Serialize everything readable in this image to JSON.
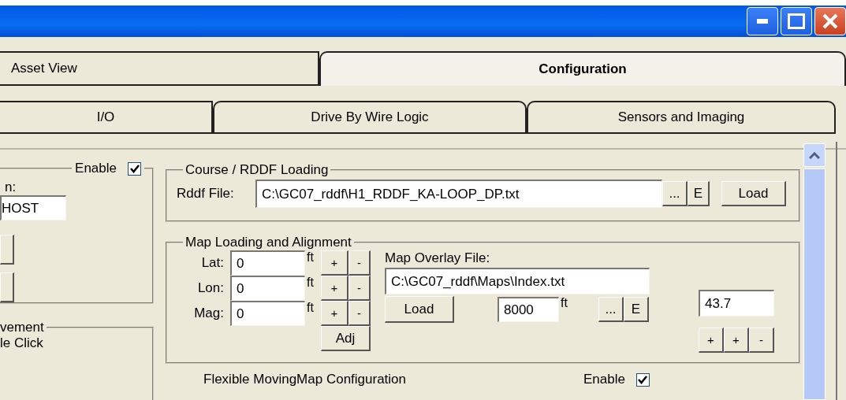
{
  "main_tabs": [
    {
      "label": "Asset View",
      "selected": false
    },
    {
      "label": "Configuration",
      "selected": true
    }
  ],
  "sub_tabs": [
    {
      "label": "I/O",
      "selected": false
    },
    {
      "label": "Drive By Wire Logic",
      "selected": false
    },
    {
      "label": "Sensors and Imaging",
      "selected": false
    }
  ],
  "left_panel": {
    "enable_label": "Enable",
    "enable_checked": true,
    "field_label": "n:",
    "field_value": "HOST",
    "group_title": "vement",
    "option_text": "le Click"
  },
  "course_group": {
    "title": "Course / RDDF Loading",
    "file_label": "Rddf File:",
    "file_value": "C:\\GC07_rddf\\H1_RDDF_KA-LOOP_DP.txt",
    "small_buttons": [
      "...",
      "E"
    ],
    "load_button": "Load"
  },
  "map_group": {
    "title": "Map Loading and Alignment",
    "offsets": [
      {
        "label": "Lat:",
        "value": "0",
        "unit": "ft",
        "buttons": [
          "+",
          "-"
        ]
      },
      {
        "label": "Lon:",
        "value": "0",
        "unit": "ft",
        "buttons": [
          "+",
          "-"
        ]
      },
      {
        "label": "Mag:",
        "value": "0",
        "unit": "ft",
        "buttons": [
          "+",
          "-"
        ]
      }
    ],
    "adjust_button": "Adj",
    "overlay_label": "Map Overlay File:",
    "overlay_value": "C:\\GC07_rddf\\Maps\\Index.txt",
    "load_button": "Load",
    "distance_value": "8000",
    "distance_unit": "ft",
    "file_buttons": [
      "...",
      "E"
    ],
    "scale_value": "43.7",
    "scale_buttons": [
      "+",
      "+",
      "-"
    ]
  },
  "flex_group": {
    "title": "Flexible MovingMap Configuration",
    "enable_label": "Enable",
    "enable_checked": true
  }
}
